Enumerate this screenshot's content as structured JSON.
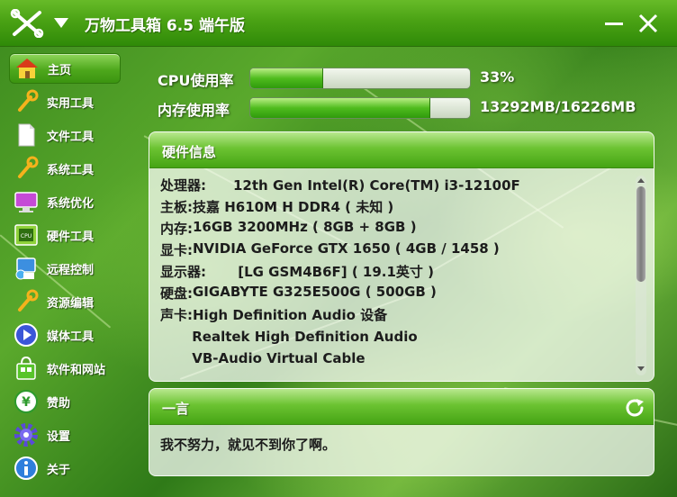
{
  "app": {
    "title": "万物工具箱 6.5 端午版"
  },
  "window": {
    "minimize_icon": "minimize-icon",
    "close_icon": "close-icon"
  },
  "sidebar": {
    "items": [
      {
        "label": "主页",
        "icon": "home-icon",
        "active": true
      },
      {
        "label": "实用工具",
        "icon": "wrench-icon",
        "active": false
      },
      {
        "label": "文件工具",
        "icon": "file-icon",
        "active": false
      },
      {
        "label": "系统工具",
        "icon": "wrench-icon",
        "active": false
      },
      {
        "label": "系统优化",
        "icon": "monitor-icon",
        "active": false
      },
      {
        "label": "硬件工具",
        "icon": "cpu-icon",
        "active": false
      },
      {
        "label": "远程控制",
        "icon": "remote-icon",
        "active": false
      },
      {
        "label": "资源编辑",
        "icon": "wrench-icon",
        "active": false
      },
      {
        "label": "媒体工具",
        "icon": "play-icon",
        "active": false
      },
      {
        "label": "软件和网站",
        "icon": "shopping-bag-icon",
        "active": false
      },
      {
        "label": "赞助",
        "icon": "yen-icon",
        "active": false
      },
      {
        "label": "设置",
        "icon": "gear-icon",
        "active": false
      },
      {
        "label": "关于",
        "icon": "info-icon",
        "active": false
      }
    ],
    "cpu_badge": "CPU"
  },
  "usage": {
    "cpu": {
      "label": "CPU使用率",
      "value": "33%",
      "fraction": 0.33
    },
    "memory": {
      "label": "内存使用率",
      "value": "13292MB/16226MB",
      "fraction": 0.819
    }
  },
  "hardware": {
    "title": "硬件信息",
    "rows": [
      {
        "key": "处理器:",
        "value": "　　12th Gen Intel(R) Core(TM) i3-12100F"
      },
      {
        "key": "主板:",
        "value": " 技嘉 H610M H DDR4 ( 未知 )"
      },
      {
        "key": "内存:",
        "value": " 16GB 3200MHz ( 8GB + 8GB )"
      },
      {
        "key": "显卡:",
        "value": " NVIDIA GeForce GTX 1650 ( 4GB / 1458 )"
      },
      {
        "key": "显示器:",
        "value": "　　 [LG GSM4B6F] ( 19.1英寸 )"
      },
      {
        "key": "硬盘:",
        "value": " GIGABYTE G325E500G ( 500GB )"
      },
      {
        "key": "声卡:",
        "value": " High Definition Audio 设备"
      },
      {
        "key": "",
        "value": "　　 Realtek High Definition Audio"
      },
      {
        "key": "",
        "value": "　　 VB-Audio Virtual Cable"
      }
    ]
  },
  "quote": {
    "title": "一言",
    "text": "我不努力，就见不到你了啊。",
    "refresh_icon": "refresh-icon"
  }
}
